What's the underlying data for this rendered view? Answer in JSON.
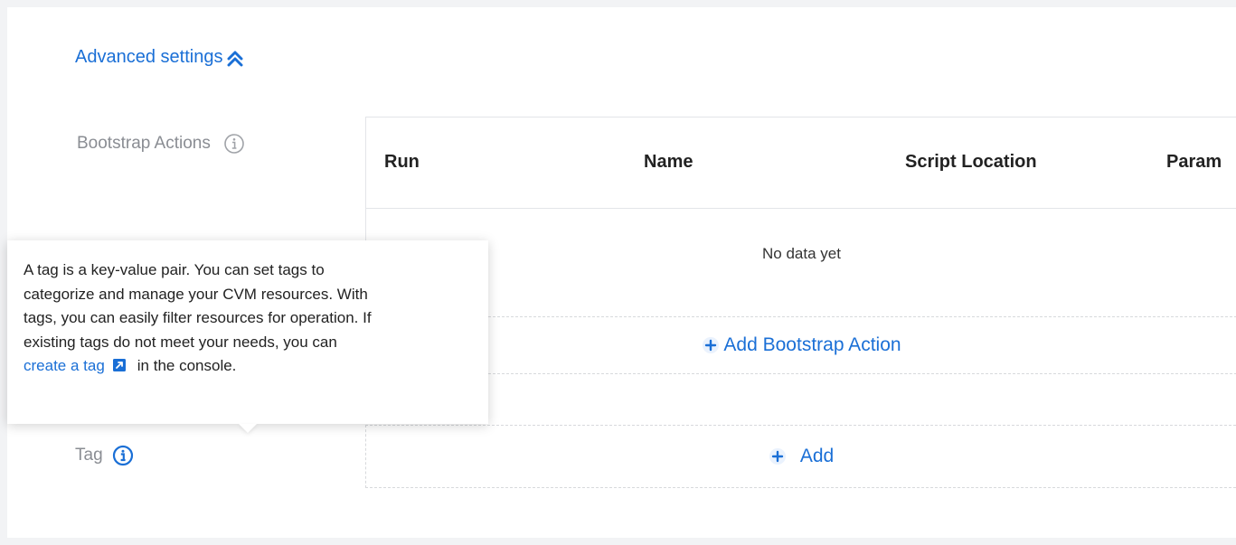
{
  "advanced": {
    "label": "Advanced settings",
    "icon": "double-chevron-up-icon"
  },
  "bootstrap": {
    "label": "Bootstrap Actions",
    "columns": [
      "Run",
      "Name",
      "Script Location",
      "Param"
    ],
    "empty_text": "No data yet",
    "add_label": "Add Bootstrap Action"
  },
  "tag": {
    "label": "Tag",
    "add_label": "Add"
  },
  "tooltip": {
    "text": "A tag is a key-value pair. You can set tags to categorize and manage your CVM resources. With tags, you can easily filter resources for operation. If existing tags do not meet your needs, you can",
    "line1": "A tag is a key-value pair. You can set tags to",
    "line2": "categorize and manage your CVM resources. With",
    "line3": "tags, you can easily filter resources for operation. If",
    "line4": "existing tags do not meet your needs, you can",
    "link": "create a tag",
    "suffix": "in the console."
  },
  "colors": {
    "accent": "#1a6fd6",
    "label": "#8a8d93",
    "border": "#e3e5e8"
  }
}
